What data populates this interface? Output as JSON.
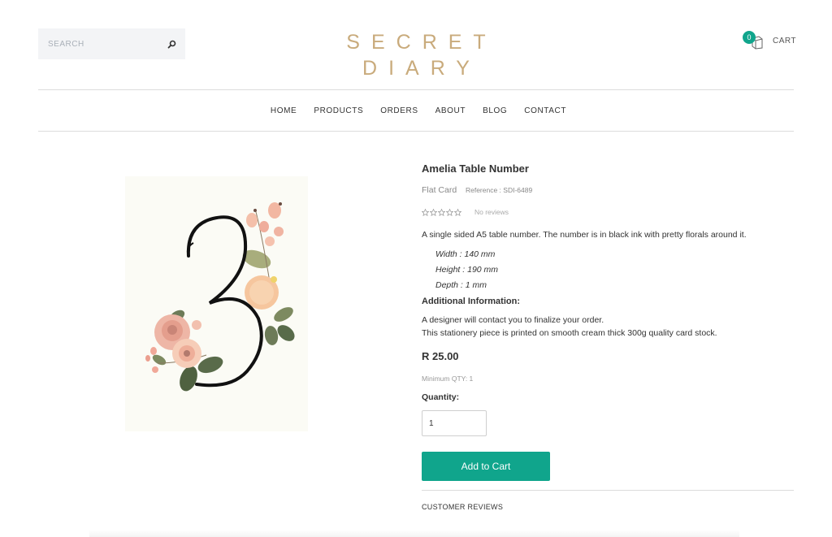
{
  "header": {
    "search_placeholder": "SEARCH",
    "logo": "SECRET DIARY",
    "cart_count": "0",
    "cart_label": "CART",
    "accent_color": "#10a58c",
    "logo_color": "#c9ab7c"
  },
  "nav": {
    "items": [
      "HOME",
      "PRODUCTS",
      "ORDERS",
      "ABOUT",
      "BLOG",
      "CONTACT"
    ]
  },
  "product": {
    "image_number": "3",
    "title": "Amelia Table Number",
    "type": "Flat Card",
    "reference": "Reference : SDI-6489",
    "rating_stars": 0,
    "reviews_text": "No reviews",
    "description": "A single sided A5 table number. The number is in black ink with pretty florals around it.",
    "dimensions": [
      "Width : 140 mm",
      "Height : 190 mm",
      "Depth : 1 mm"
    ],
    "additional_title": "Additional Information:",
    "additional_lines": [
      "A designer will contact you to finalize your order.",
      "This stationery piece is printed on smooth cream thick 300g quality card stock."
    ],
    "price": "R 25.00",
    "min_qty": "Minimum QTY: 1",
    "quantity_label": "Quantity:",
    "quantity_value": "1",
    "add_to_cart": "Add to Cart",
    "reviews_heading": "CUSTOMER REVIEWS"
  }
}
